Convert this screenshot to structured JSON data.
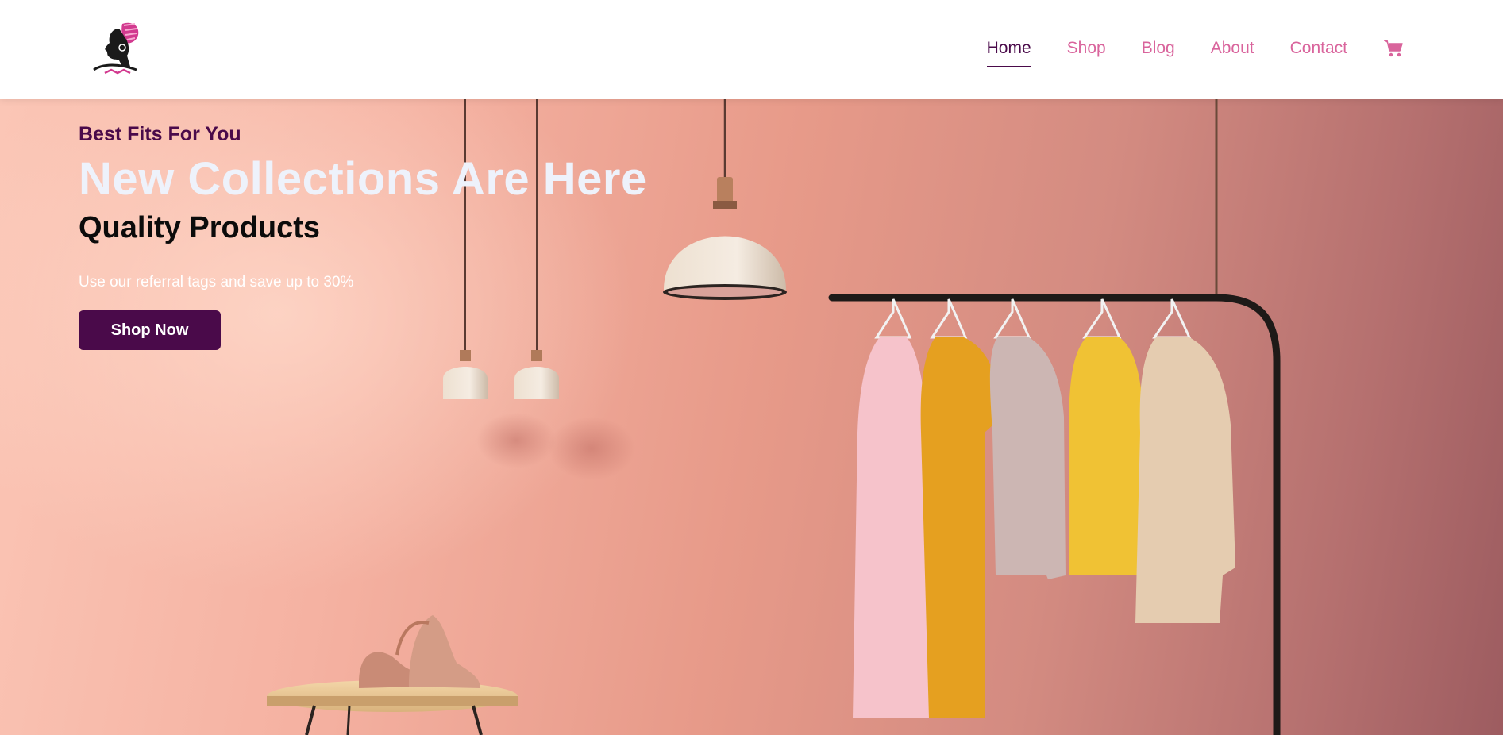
{
  "nav": {
    "items": [
      {
        "label": "Home",
        "active": true
      },
      {
        "label": "Shop",
        "active": false
      },
      {
        "label": "Blog",
        "active": false
      },
      {
        "label": "About",
        "active": false
      },
      {
        "label": "Contact",
        "active": false
      }
    ],
    "cart_icon": "shopping-cart-icon"
  },
  "hero": {
    "eyebrow": "Best Fits For You",
    "headline": "New Collections Are Here",
    "subheading": "Quality Products",
    "tagline": "Use our referral tags and save up to 30%",
    "cta_label": "Shop Now"
  },
  "colors": {
    "brand_primary": "#4a0a4a",
    "nav_link": "#d9649c",
    "headline": "#eef2fb"
  }
}
